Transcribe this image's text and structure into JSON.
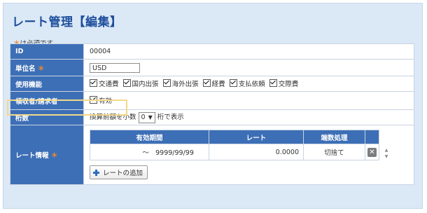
{
  "page": {
    "title": "レート管理【編集】",
    "required_note_mark": "＊",
    "required_note_text": "は必須です"
  },
  "form": {
    "id_label": "ID",
    "id_value": "00004",
    "unit_label": "単位名",
    "unit_required_mark": "＊",
    "unit_value": "USD",
    "usage_label": "使用機能",
    "usage_options": [
      {
        "label": "交通費",
        "checked": true
      },
      {
        "label": "国内出張",
        "checked": true
      },
      {
        "label": "海外出張",
        "checked": true
      },
      {
        "label": "経費",
        "checked": true
      },
      {
        "label": "支払依頼",
        "checked": true
      },
      {
        "label": "交際費",
        "checked": true
      }
    ],
    "payee_label": "領収者/請求者",
    "payee_option": "有効",
    "digits_label": "桁数",
    "digits_prefix": "換算前額を小数",
    "digits_value": "0",
    "digits_suffix": "桁で表示",
    "rate_label": "レート情報",
    "rate_required_mark": "＊"
  },
  "rates": {
    "headers": [
      "有効期間",
      "レート",
      "端数処理"
    ],
    "rows": [
      {
        "period_tilde": "～",
        "period_end": "9999/99/99",
        "rate": "0.0000",
        "rounding": "切捨て"
      }
    ],
    "delete_icon": "close-icon",
    "add_label": "レートの追加"
  }
}
